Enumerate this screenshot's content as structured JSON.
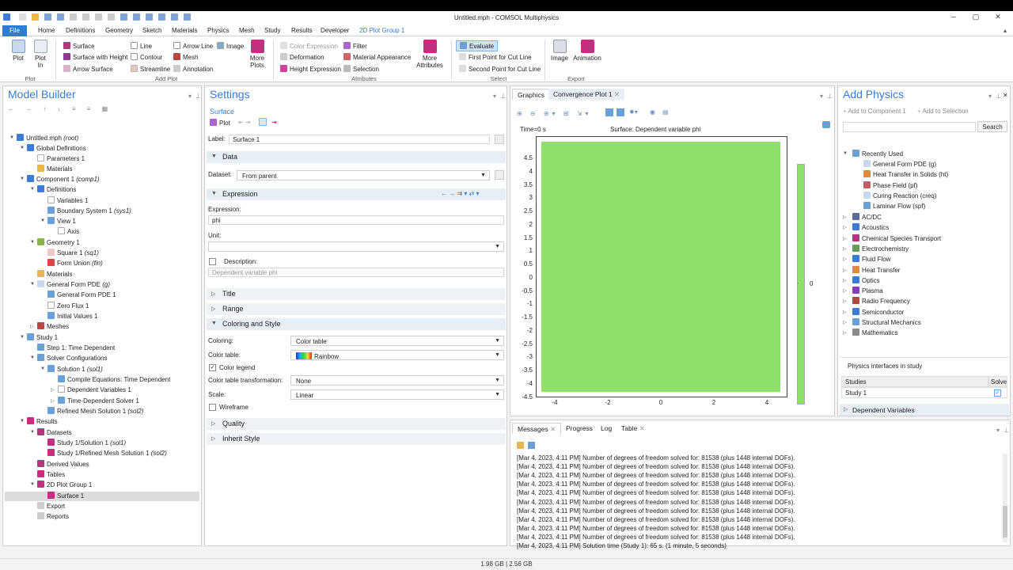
{
  "window": {
    "title": "Untitled.mph - COMSOL Multiphysics"
  },
  "tabs": [
    {
      "label": "File"
    },
    {
      "label": "Home"
    },
    {
      "label": "Definitions"
    },
    {
      "label": "Geometry"
    },
    {
      "label": "Sketch"
    },
    {
      "label": "Materials"
    },
    {
      "label": "Physics"
    },
    {
      "label": "Mesh"
    },
    {
      "label": "Study"
    },
    {
      "label": "Results"
    },
    {
      "label": "Developer"
    },
    {
      "label": "2D Plot Group 1"
    }
  ],
  "ribbon": {
    "plot": {
      "plot": "Plot",
      "plot_in": "Plot\nIn",
      "group": "Plot"
    },
    "add_plot": {
      "surface": "Surface",
      "surface_height": "Surface with Height",
      "arrow_surface": "Arrow Surface",
      "line": "Line",
      "contour": "Contour",
      "streamline": "Streamline",
      "arrow_line": "Arrow Line",
      "mesh": "Mesh",
      "annotation": "Annotation",
      "image": "Image",
      "more_plots": "More\nPlots",
      "group": "Add Plot"
    },
    "attributes": {
      "color_expression": "Color Expression",
      "deformation": "Deformation",
      "height_expression": "Height Expression",
      "filter": "Filter",
      "material_appearance": "Material Appearance",
      "selection": "Selection",
      "more_attributes": "More\nAttributes",
      "group": "Attributes"
    },
    "select": {
      "evaluate": "Evaluate",
      "first_point": "First Point for Cut Line",
      "second_point": "Second Point for Cut Line",
      "group": "Select"
    },
    "export": {
      "image": "Image",
      "animation": "Animation",
      "group": "Export"
    }
  },
  "model_builder": {
    "title": "Model Builder",
    "nodes": [
      {
        "label": "Untitled.mph",
        "tag": "(root)"
      },
      {
        "label": "Global Definitions",
        "tag": ""
      },
      {
        "label": "Parameters 1",
        "tag": ""
      },
      {
        "label": "Materials",
        "tag": ""
      },
      {
        "label": "Component 1",
        "tag": "(comp1)"
      },
      {
        "label": "Definitions",
        "tag": ""
      },
      {
        "label": "Variables 1",
        "tag": ""
      },
      {
        "label": "Boundary System 1",
        "tag": "(sys1)"
      },
      {
        "label": "View 1",
        "tag": ""
      },
      {
        "label": "Axis",
        "tag": ""
      },
      {
        "label": "Geometry 1",
        "tag": ""
      },
      {
        "label": "Square 1",
        "tag": "(sq1)"
      },
      {
        "label": "Form Union",
        "tag": "(fin)"
      },
      {
        "label": "Materials",
        "tag": ""
      },
      {
        "label": "General Form PDE",
        "tag": "(g)"
      },
      {
        "label": "General Form PDE 1",
        "tag": ""
      },
      {
        "label": "Zero Flux 1",
        "tag": ""
      },
      {
        "label": "Initial Values 1",
        "tag": ""
      },
      {
        "label": "Meshes",
        "tag": ""
      },
      {
        "label": "Study 1",
        "tag": ""
      },
      {
        "label": "Step 1: Time Dependent",
        "tag": ""
      },
      {
        "label": "Solver Configurations",
        "tag": ""
      },
      {
        "label": "Solution 1",
        "tag": "(sol1)"
      },
      {
        "label": "Compile Equations: Time Dependent",
        "tag": ""
      },
      {
        "label": "Dependent Variables 1",
        "tag": ""
      },
      {
        "label": "Time-Dependent Solver 1",
        "tag": ""
      },
      {
        "label": "Refined Mesh Solution 1",
        "tag": "(sol2)"
      },
      {
        "label": "Results",
        "tag": ""
      },
      {
        "label": "Datasets",
        "tag": ""
      },
      {
        "label": "Study 1/Solution 1",
        "tag": "(sol1)"
      },
      {
        "label": "Study 1/Refined Mesh Solution 1",
        "tag": "(sol2)"
      },
      {
        "label": "Derived Values",
        "tag": ""
      },
      {
        "label": "Tables",
        "tag": ""
      },
      {
        "label": "2D Plot Group 1",
        "tag": ""
      },
      {
        "label": "Surface 1",
        "tag": ""
      },
      {
        "label": "Export",
        "tag": ""
      },
      {
        "label": "Reports",
        "tag": ""
      }
    ]
  },
  "settings": {
    "title": "Settings",
    "subtitle": "Surface",
    "plot_button": "Plot",
    "label_caption": "Label:",
    "label_value": "Surface 1",
    "sections": {
      "data": "Data",
      "expression": "Expression",
      "title": "Title",
      "range": "Range",
      "coloring": "Coloring and Style",
      "quality": "Quality",
      "inherit": "Inherit Style"
    },
    "dataset_caption": "Dataset:",
    "dataset_value": "From parent",
    "expression_caption": "Expression:",
    "expression_value": "phi",
    "unit_caption": "Unit:",
    "description_caption": "Description:",
    "description_value": "Dependent variable phi",
    "coloring_caption": "Coloring:",
    "coloring_value": "Color table",
    "color_table_caption": "Color table:",
    "color_table_value": "Rainbow",
    "color_legend": "Color legend",
    "color_table_transformation_caption": "Color table transformation:",
    "color_table_transformation_value": "None",
    "scale_caption": "Scale:",
    "scale_value": "Linear",
    "wireframe": "Wireframe"
  },
  "graphics": {
    "tabs": [
      "Graphics",
      "Convergence Plot 1"
    ],
    "time_label": "Time=0 s",
    "plot_title": "Surface: Dependent variable phi",
    "y_ticks": [
      "4.5",
      "4",
      "3.5",
      "3",
      "2.5",
      "2",
      "1.5",
      "1",
      "0.5",
      "0",
      "-0.5",
      "-1",
      "-1.5",
      "-2",
      "-2.5",
      "-3",
      "-3.5",
      "-4",
      "-4.5"
    ],
    "x_ticks": [
      "-4",
      "-2",
      "0",
      "2",
      "4"
    ],
    "legend_value": "0",
    "fill_color": "#8fe06a"
  },
  "messages": {
    "tabs": [
      "Messages",
      "Progress",
      "Log",
      "Table"
    ],
    "lines": [
      "[Mar 4, 2023, 4:11 PM] Number of degrees of freedom solved for: 81538 (plus 1448 internal DOFs).",
      "[Mar 4, 2023, 4:11 PM] Number of degrees of freedom solved for: 81538 (plus 1448 internal DOFs).",
      "[Mar 4, 2023, 4:11 PM] Number of degrees of freedom solved for: 81538 (plus 1448 internal DOFs).",
      "[Mar 4, 2023, 4:11 PM] Number of degrees of freedom solved for: 81538 (plus 1448 internal DOFs).",
      "[Mar 4, 2023, 4:11 PM] Number of degrees of freedom solved for: 81538 (plus 1448 internal DOFs).",
      "[Mar 4, 2023, 4:11 PM] Number of degrees of freedom solved for: 81538 (plus 1448 internal DOFs).",
      "[Mar 4, 2023, 4:11 PM] Number of degrees of freedom solved for: 81538 (plus 1448 internal DOFs).",
      "[Mar 4, 2023, 4:11 PM] Number of degrees of freedom solved for: 81538 (plus 1448 internal DOFs).",
      "[Mar 4, 2023, 4:11 PM] Number of degrees of freedom solved for: 81538 (plus 1448 internal DOFs).",
      "[Mar 4, 2023, 4:11 PM] Number of degrees of freedom solved for: 81538 (plus 1448 internal DOFs).",
      "[Mar 4, 2023, 4:11 PM] Solution time (Study 1): 65 s. (1 minute, 5 seconds)"
    ]
  },
  "add_physics": {
    "title": "Add Physics",
    "add_to_component": "Add to Component 1",
    "add_to_selection": "Add to Selection",
    "search_button": "Search",
    "recently_used": "Recently Used",
    "recent": [
      "General Form PDE (g)",
      "Heat Transfer in Solids (ht)",
      "Phase Field (pf)",
      "Curing Reaction (creq)",
      "Laminar Flow (spf)"
    ],
    "categories": [
      "AC/DC",
      "Acoustics",
      "Chemical Species Transport",
      "Electrochemistry",
      "Fluid Flow",
      "Heat Transfer",
      "Optics",
      "Plasma",
      "Radio Frequency",
      "Semiconductor",
      "Structural Mechanics",
      "Mathematics"
    ],
    "physics_in_study": "Physics interfaces in study",
    "studies_header": "Studies",
    "solve_header": "Solve",
    "study_row": "Study 1",
    "dependent_variables": "Dependent Variables"
  },
  "status": {
    "memory": "1.98 GB | 2.56 GB"
  }
}
